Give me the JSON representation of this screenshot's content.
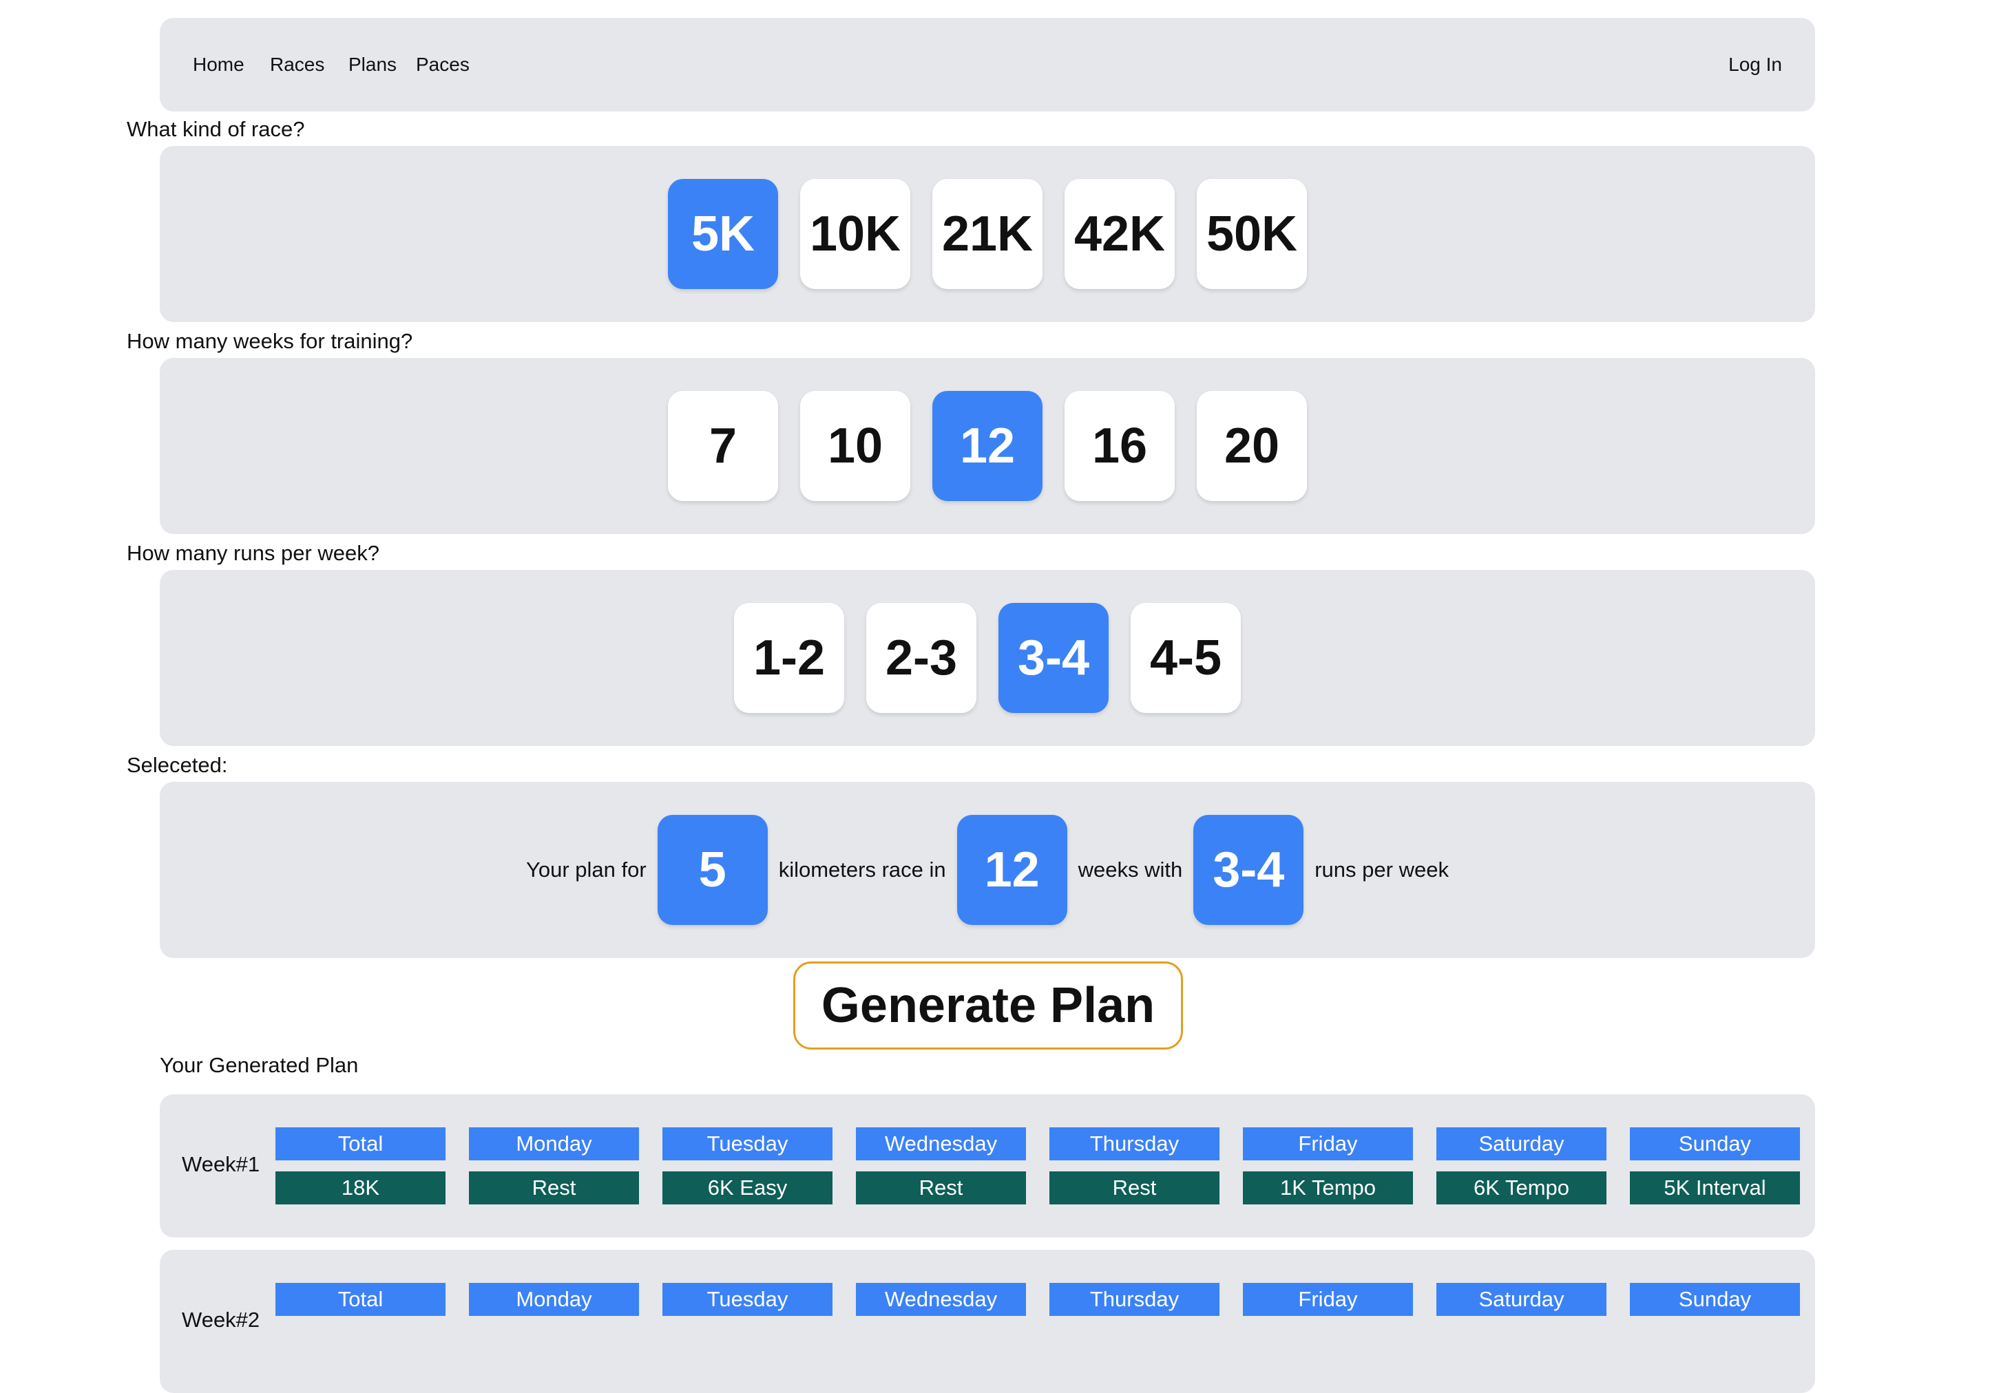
{
  "nav": {
    "links": [
      "Home",
      "Races",
      "Plans",
      "Paces"
    ],
    "login": "Log In"
  },
  "race": {
    "question": "What kind of race?",
    "options": [
      "5K",
      "10K",
      "21K",
      "42K",
      "50K"
    ],
    "selected": "5K"
  },
  "weeks": {
    "question": "How many weeks for training?",
    "options": [
      "7",
      "10",
      "12",
      "16",
      "20"
    ],
    "selected": "12"
  },
  "runs": {
    "question": "How many runs per week?",
    "options": [
      "1-2",
      "2-3",
      "3-4",
      "4-5"
    ],
    "selected": "3-4"
  },
  "summary": {
    "label": "Seleceted:",
    "text1": "Your plan for",
    "distance": "5",
    "text2": "kilometers race in",
    "weeks": "12",
    "text3": "weeks with",
    "runs": "3-4",
    "text4": "runs per week"
  },
  "generate_label": "Generate Plan",
  "plan": {
    "title": "Your Generated Plan",
    "headers": [
      "Total",
      "Monday",
      "Tuesday",
      "Wednesday",
      "Thursday",
      "Friday",
      "Saturday",
      "Sunday"
    ],
    "weeks": [
      {
        "label": "Week#1",
        "values": [
          "18K",
          "Rest",
          "6K Easy",
          "Rest",
          "Rest",
          "1K Tempo",
          "6K Tempo",
          "5K Interval"
        ]
      },
      {
        "label": "Week#2",
        "values": []
      }
    ]
  },
  "colors": {
    "accent": "#3b82f6",
    "panel": "#e5e7eb",
    "plan_cell": "#0f5e58",
    "generate_border": "#e0a020"
  }
}
